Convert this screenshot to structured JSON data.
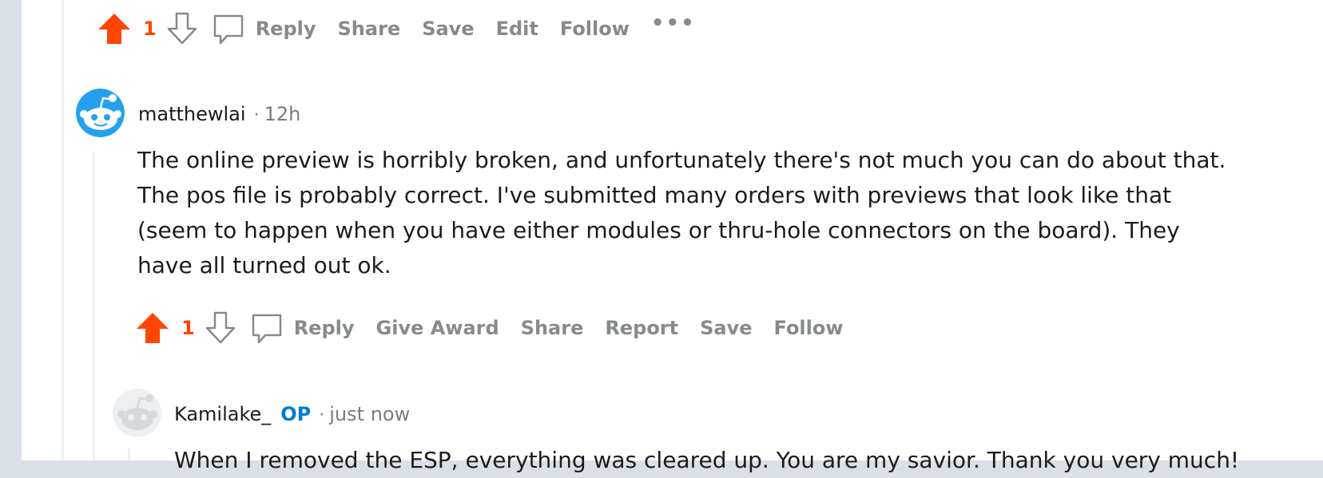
{
  "top_actions": {
    "score": "1",
    "reply": "Reply",
    "share": "Share",
    "save": "Save",
    "edit": "Edit",
    "follow": "Follow",
    "more": "•••"
  },
  "comment1": {
    "username": "matthewlai",
    "separator": "·",
    "time": "12h",
    "lines": [
      "The online preview is horribly broken, and unfortunately there's not much you can do about that.",
      "The pos file is probably correct. I've submitted many orders with previews that look like that",
      "(seem to happen when you have either modules or thru-hole connectors on the board). They",
      "have all turned out ok."
    ],
    "actions": {
      "score": "1",
      "reply": "Reply",
      "give_award": "Give Award",
      "share": "Share",
      "report": "Report",
      "save": "Save",
      "follow": "Follow"
    }
  },
  "comment2": {
    "username": "Kamilake_",
    "op_badge": "OP",
    "separator": "·",
    "time": "just now",
    "text": "When I removed the ESP, everything was cleared up. You are my savior. Thank you very much!"
  },
  "colors": {
    "upvote": "#ff4500",
    "action_gray": "#878a8c",
    "op_blue": "#0079d3",
    "avatar_blue": "#24a0ed"
  }
}
